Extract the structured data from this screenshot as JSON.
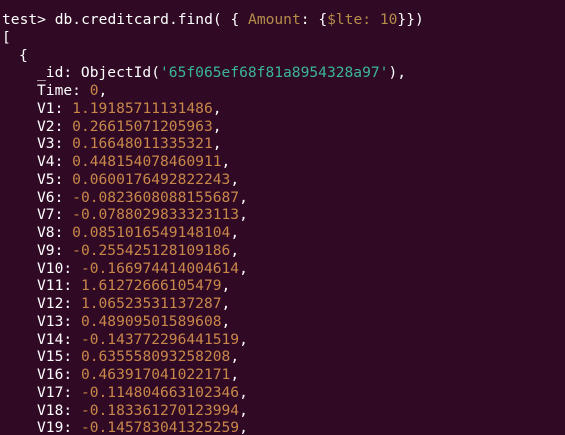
{
  "colors": {
    "background": "#300a24",
    "text": "#ffffff",
    "number": "#c9874a",
    "string": "#3ab59a",
    "operator_key": "#b58c4a"
  },
  "command": {
    "prompt": "test>",
    "prefix": " db.creditcard.find( { ",
    "amount_key": "Amount",
    "colon_brace": ": {",
    "lte_op": "$lte",
    "colon": ": ",
    "lte_value": "10",
    "suffix": "}})"
  },
  "output": {
    "open_bracket": "[",
    "open_brace": "{",
    "id_key": "_id: ObjectId(",
    "id_value": "'65f065ef68f81a8954328a97'",
    "id_close": "),",
    "time_key": "Time: ",
    "time_value": "0",
    "comma": ",",
    "fields": [
      {
        "key": "V1: ",
        "value": "1.19185711131486"
      },
      {
        "key": "V2: ",
        "value": "0.26615071205963"
      },
      {
        "key": "V3: ",
        "value": "0.16648011335321"
      },
      {
        "key": "V4: ",
        "value": "0.448154078460911"
      },
      {
        "key": "V5: ",
        "value": "0.0600176492822243"
      },
      {
        "key": "V6: ",
        "value": "-0.0823608088155687"
      },
      {
        "key": "V7: ",
        "value": "-0.0788029833323113"
      },
      {
        "key": "V8: ",
        "value": "0.0851016549148104"
      },
      {
        "key": "V9: ",
        "value": "-0.255425128109186"
      },
      {
        "key": "V10: ",
        "value": "-0.166974414004614"
      },
      {
        "key": "V11: ",
        "value": "1.61272666105479"
      },
      {
        "key": "V12: ",
        "value": "1.06523531137287"
      },
      {
        "key": "V13: ",
        "value": "0.48909501589608"
      },
      {
        "key": "V14: ",
        "value": "-0.143772296441519"
      },
      {
        "key": "V15: ",
        "value": "0.635558093258208"
      },
      {
        "key": "V16: ",
        "value": "0.463917041022171"
      },
      {
        "key": "V17: ",
        "value": "-0.114804663102346"
      },
      {
        "key": "V18: ",
        "value": "-0.183361270123994"
      },
      {
        "key": "V19: ",
        "value": "-0.145783041325259"
      }
    ]
  }
}
